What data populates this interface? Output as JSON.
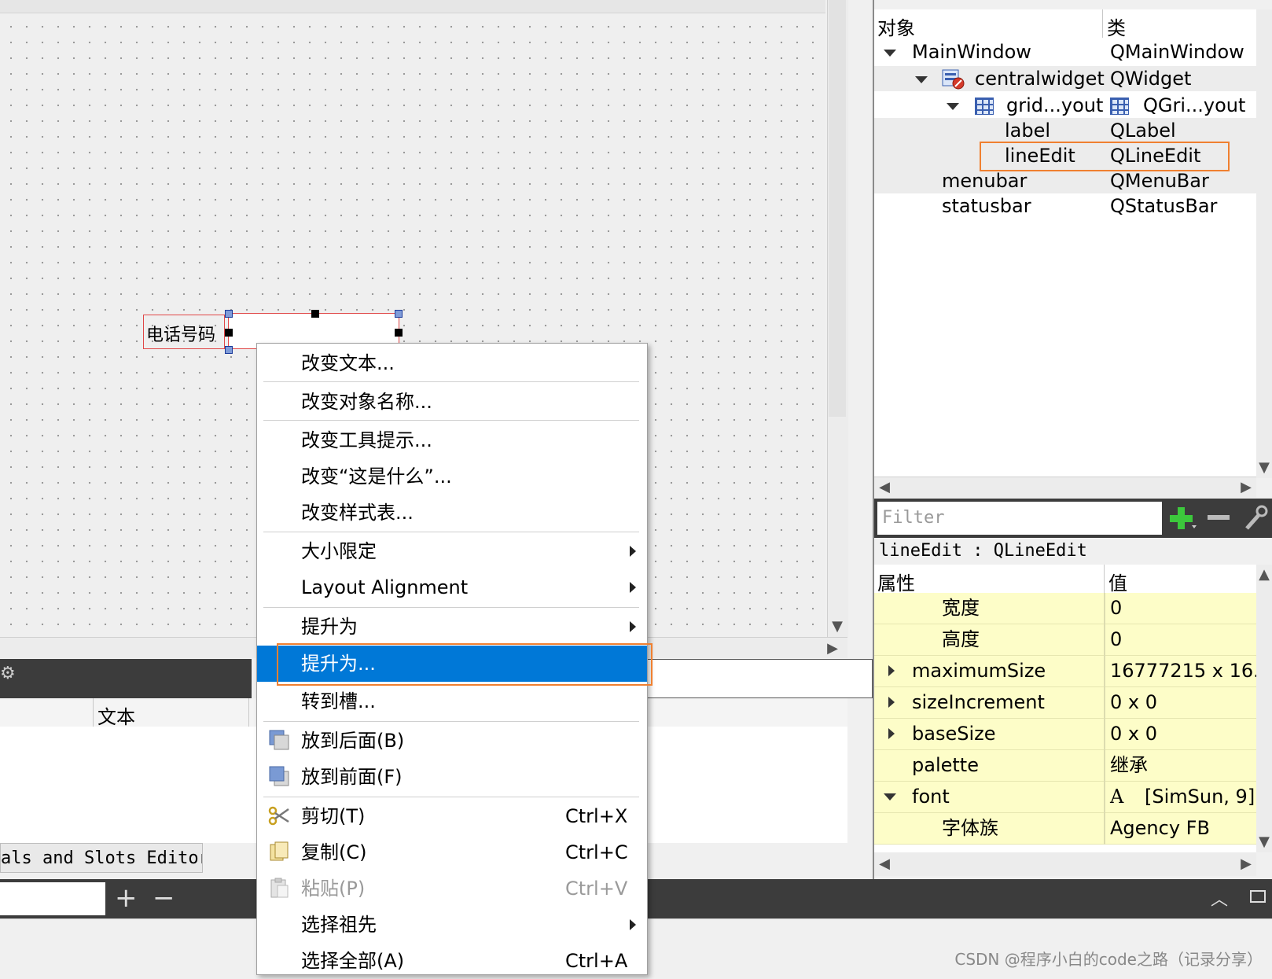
{
  "form": {
    "label_text": "电话号码"
  },
  "bottom_panel": {
    "table_header_col2": "文本",
    "tab_label": "als and Slots Editor",
    "add_label": "+",
    "remove_label": "−"
  },
  "object_inspector": {
    "col_object": "对象",
    "col_class": "类",
    "rows": [
      {
        "name": "MainWindow",
        "cls": "QMainWindow"
      },
      {
        "name": "centralwidget",
        "cls": "QWidget"
      },
      {
        "name": "grid...yout",
        "cls": "QGri...yout"
      },
      {
        "name": "label",
        "cls": "QLabel"
      },
      {
        "name": "lineEdit",
        "cls": "QLineEdit"
      },
      {
        "name": "menubar",
        "cls": "QMenuBar"
      },
      {
        "name": "statusbar",
        "cls": "QStatusBar"
      }
    ]
  },
  "property_editor": {
    "filter_placeholder": "Filter",
    "object_line": "lineEdit : QLineEdit",
    "col_property": "属性",
    "col_value": "值",
    "rows": [
      {
        "name": "宽度",
        "value": "0"
      },
      {
        "name": "高度",
        "value": "0"
      },
      {
        "name": "maximumSize",
        "value": "16777215 x 16..."
      },
      {
        "name": "sizeIncrement",
        "value": "0 x 0"
      },
      {
        "name": "baseSize",
        "value": "0 x 0"
      },
      {
        "name": "palette",
        "value": "继承"
      },
      {
        "name": "font",
        "value": "[SimSun, 9]",
        "value_icon": "A"
      },
      {
        "name": "字体族",
        "value": "Agency FB"
      }
    ]
  },
  "context_menu": {
    "items": [
      {
        "label": "改变文本..."
      },
      {
        "label": "改变对象名称..."
      },
      {
        "label": "改变工具提示..."
      },
      {
        "label": "改变“这是什么”..."
      },
      {
        "label": "改变样式表..."
      },
      {
        "label": "大小限定"
      },
      {
        "label": "Layout Alignment"
      },
      {
        "label": "提升为"
      },
      {
        "label": "提升为..."
      },
      {
        "label": "转到槽..."
      },
      {
        "label": "放到后面(B)"
      },
      {
        "label": "放到前面(F)"
      },
      {
        "label": "剪切(T)",
        "shortcut": "Ctrl+X"
      },
      {
        "label": "复制(C)",
        "shortcut": "Ctrl+C"
      },
      {
        "label": "粘贴(P)",
        "shortcut": "Ctrl+V"
      },
      {
        "label": "选择祖先"
      },
      {
        "label": "选择全部(A)",
        "shortcut": "Ctrl+A"
      }
    ]
  },
  "watermark": "CSDN @程序小白的code之路（记录分享）",
  "colors": {
    "selection": "#0078d7",
    "highlight_box": "#f08030",
    "property_row": "#fdfdc8",
    "plus_green": "#3cc83c"
  }
}
